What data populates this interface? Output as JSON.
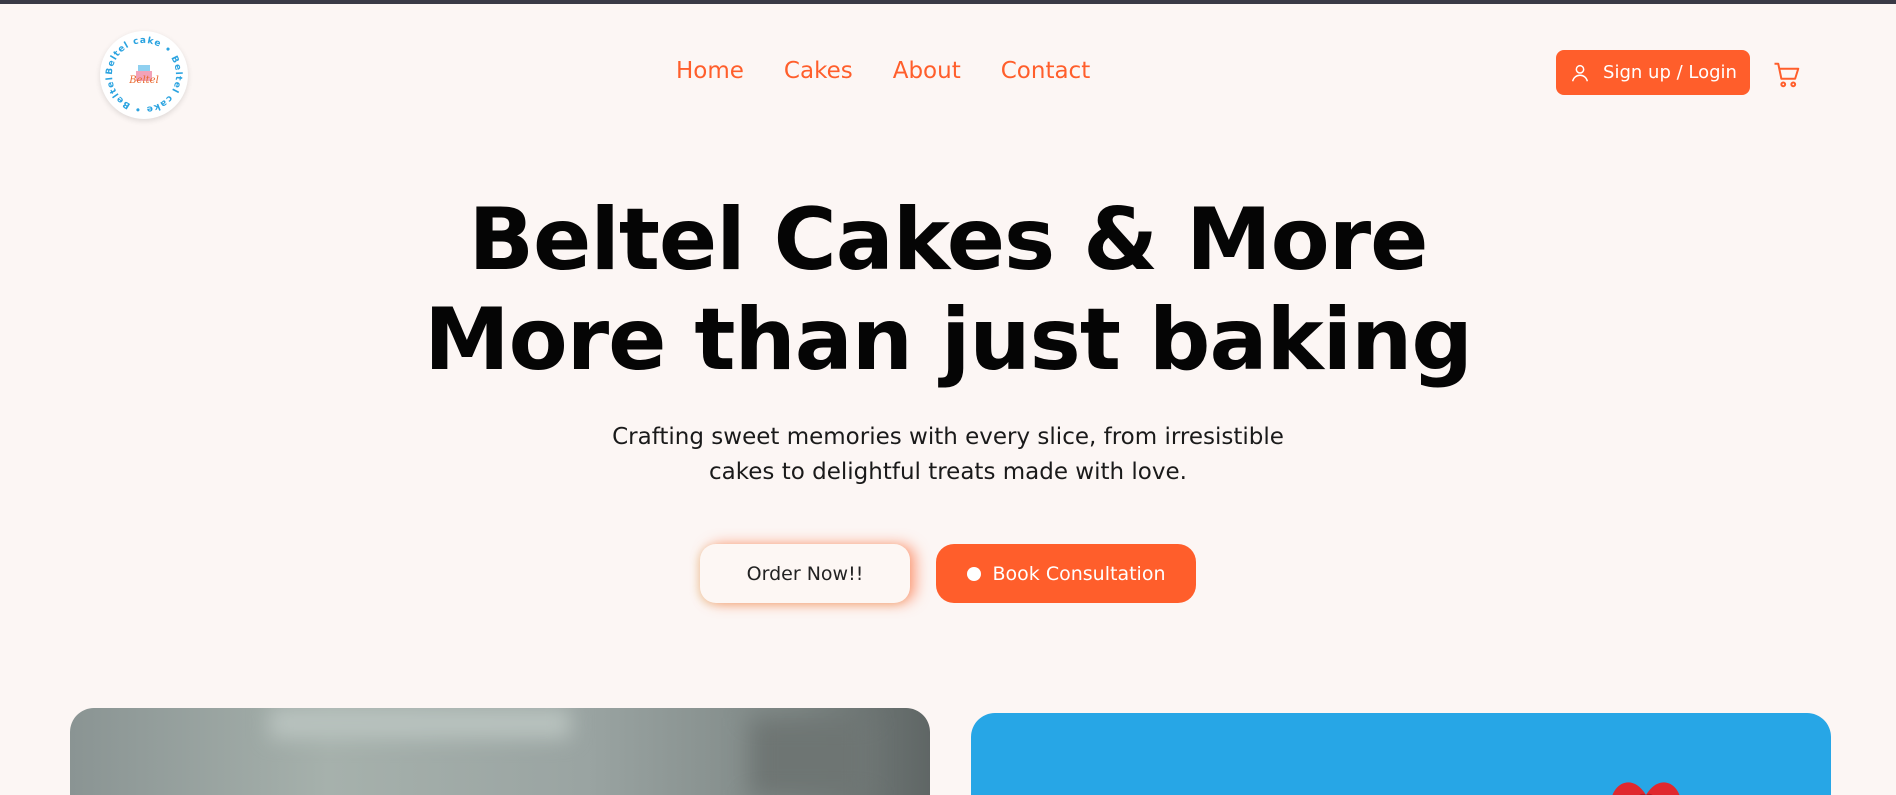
{
  "nav": {
    "logo_alt": "Beltel cake",
    "logo_ring_text": "Beltel cake • Beltel cake • Beltel cake •",
    "logo_center_text": "Beltel",
    "links": [
      {
        "label": "Home"
      },
      {
        "label": "Cakes"
      },
      {
        "label": "About"
      },
      {
        "label": "Contact"
      }
    ],
    "signup_label": "Sign up / Login",
    "cart_icon": "cart-icon",
    "user_icon": "user-icon"
  },
  "hero": {
    "title_line1": "Beltel Cakes & More",
    "title_line2": "More than just baking",
    "subtitle": "Crafting sweet memories with every slice, from irresistible cakes to delightful treats made with love.",
    "order_label": "Order Now!!",
    "book_label": "Book Consultation"
  },
  "colors": {
    "accent": "#ff5e2b",
    "background": "#fcf6f4",
    "card_blue": "#27a6e6"
  }
}
